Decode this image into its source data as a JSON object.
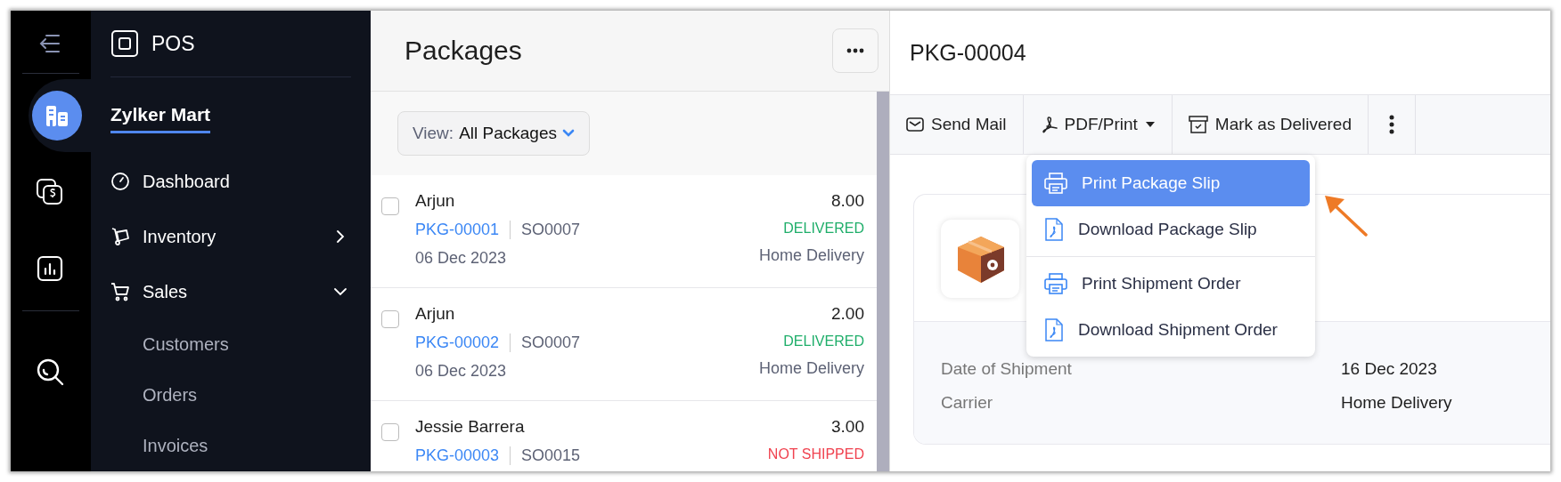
{
  "rail": {
    "items": [
      {
        "kind": "building",
        "selected": true
      },
      {
        "kind": "money",
        "selected": false
      },
      {
        "kind": "chart",
        "selected": false
      }
    ]
  },
  "nav": {
    "app_name": "POS",
    "org": {
      "name": "Zylker Mart",
      "selected": true
    },
    "items": [
      {
        "label": "Dashboard",
        "kind": "link"
      },
      {
        "label": "Inventory",
        "kind": "group",
        "expanded": false
      },
      {
        "label": "Sales",
        "kind": "group",
        "expanded": true,
        "children": [
          {
            "label": "Customers"
          },
          {
            "label": "Orders"
          },
          {
            "label": "Invoices"
          }
        ]
      }
    ]
  },
  "list": {
    "title": "Packages",
    "view": {
      "label": "View:",
      "value": "All Packages"
    },
    "rows": [
      {
        "checked": false,
        "name": "Arjun",
        "package": "PKG-00001",
        "order": "SO0007",
        "date": "06 Dec 2023",
        "amount": "8.00",
        "status": "DELIVERED",
        "color": "#1fae6a",
        "carrier": "Home Delivery"
      },
      {
        "checked": false,
        "name": "Arjun",
        "package": "PKG-00002",
        "order": "SO0007",
        "date": "06 Dec 2023",
        "amount": "2.00",
        "status": "DELIVERED",
        "color": "#1fae6a",
        "carrier": "Home Delivery"
      },
      {
        "checked": false,
        "name": "Jessie Barrera",
        "package": "PKG-00003",
        "order": "SO0015",
        "amount": "3.00",
        "status": "NOT SHIPPED",
        "color": "#f0424f"
      }
    ]
  },
  "detail": {
    "title": "PKG-00004",
    "toolbar": [
      {
        "kind": "mail",
        "label": "Send Mail"
      },
      {
        "kind": "pdf",
        "label": "PDF/Print"
      },
      {
        "kind": "delivered",
        "label": "Mark as Delivered"
      },
      {
        "kind": "more"
      }
    ],
    "menu": {
      "sections": [
        {
          "items": [
            {
              "kind": "print",
              "label": "Print Package Slip",
              "selected": true
            },
            {
              "kind": "pdf",
              "label": "Download Package Slip",
              "selected": false
            }
          ]
        },
        {
          "items": [
            {
              "kind": "print",
              "label": "Print Shipment Order",
              "selected": false
            },
            {
              "kind": "pdf",
              "label": "Download Shipment Order",
              "selected": false
            }
          ]
        }
      ]
    },
    "fields": [
      {
        "label": "Date of Shipment",
        "value": "16 Dec 2023"
      },
      {
        "label": "Carrier",
        "value": "Home Delivery"
      }
    ]
  }
}
